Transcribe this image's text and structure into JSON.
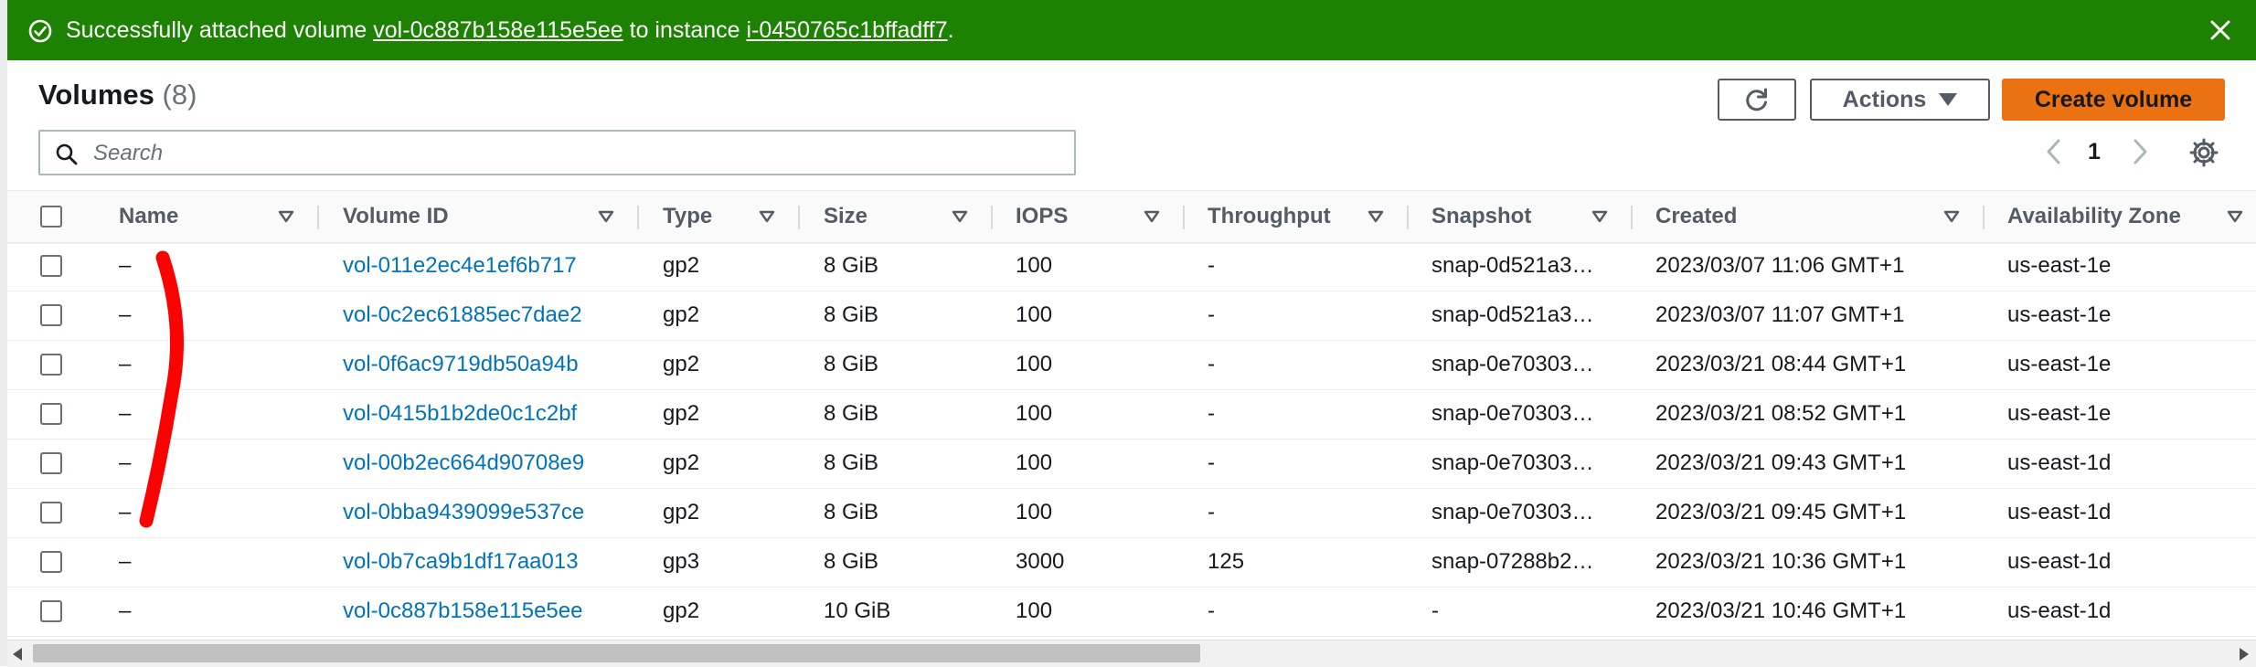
{
  "flash": {
    "prefix": "Successfully attached volume ",
    "volume_link": "vol-0c887b158e115e5ee",
    "middle": " to instance ",
    "instance_link": "i-0450765c1bffadff7",
    "suffix": ".",
    "color": "#1d8102"
  },
  "header": {
    "title": "Volumes",
    "count": "(8)",
    "actions_label": "Actions",
    "create_label": "Create volume"
  },
  "search": {
    "placeholder": "Search"
  },
  "pagination": {
    "page": "1"
  },
  "table": {
    "columns": [
      "Name",
      "Volume ID",
      "Type",
      "Size",
      "IOPS",
      "Throughput",
      "Snapshot",
      "Created",
      "Availability Zone"
    ],
    "rows": [
      {
        "name": "–",
        "volume_id": "vol-011e2ec4e1ef6b717",
        "type": "gp2",
        "size": "8 GiB",
        "iops": "100",
        "throughput": "-",
        "snapshot": "snap-0d521a3…",
        "created": "2023/03/07 11:06 GMT+1",
        "az": "us-east-1e"
      },
      {
        "name": "–",
        "volume_id": "vol-0c2ec61885ec7dae2",
        "type": "gp2",
        "size": "8 GiB",
        "iops": "100",
        "throughput": "-",
        "snapshot": "snap-0d521a3…",
        "created": "2023/03/07 11:07 GMT+1",
        "az": "us-east-1e"
      },
      {
        "name": "–",
        "volume_id": "vol-0f6ac9719db50a94b",
        "type": "gp2",
        "size": "8 GiB",
        "iops": "100",
        "throughput": "-",
        "snapshot": "snap-0e70303…",
        "created": "2023/03/21 08:44 GMT+1",
        "az": "us-east-1e"
      },
      {
        "name": "–",
        "volume_id": "vol-0415b1b2de0c1c2bf",
        "type": "gp2",
        "size": "8 GiB",
        "iops": "100",
        "throughput": "-",
        "snapshot": "snap-0e70303…",
        "created": "2023/03/21 08:52 GMT+1",
        "az": "us-east-1e"
      },
      {
        "name": "–",
        "volume_id": "vol-00b2ec664d90708e9",
        "type": "gp2",
        "size": "8 GiB",
        "iops": "100",
        "throughput": "-",
        "snapshot": "snap-0e70303…",
        "created": "2023/03/21 09:43 GMT+1",
        "az": "us-east-1d"
      },
      {
        "name": "–",
        "volume_id": "vol-0bba9439099e537ce",
        "type": "gp2",
        "size": "8 GiB",
        "iops": "100",
        "throughput": "-",
        "snapshot": "snap-0e70303…",
        "created": "2023/03/21 09:45 GMT+1",
        "az": "us-east-1d"
      },
      {
        "name": "–",
        "volume_id": "vol-0b7ca9b1df17aa013",
        "type": "gp3",
        "size": "8 GiB",
        "iops": "3000",
        "throughput": "125",
        "snapshot": "snap-07288b2…",
        "created": "2023/03/21 10:36 GMT+1",
        "az": "us-east-1d"
      },
      {
        "name": "–",
        "volume_id": "vol-0c887b158e115e5ee",
        "type": "gp2",
        "size": "10 GiB",
        "iops": "100",
        "throughput": "-",
        "snapshot": "-",
        "created": "2023/03/21 10:46 GMT+1",
        "az": "us-east-1d"
      }
    ]
  },
  "colors": {
    "link": "#0073bb",
    "primary_button": "#ec7211",
    "annotation": "#ff0000"
  }
}
